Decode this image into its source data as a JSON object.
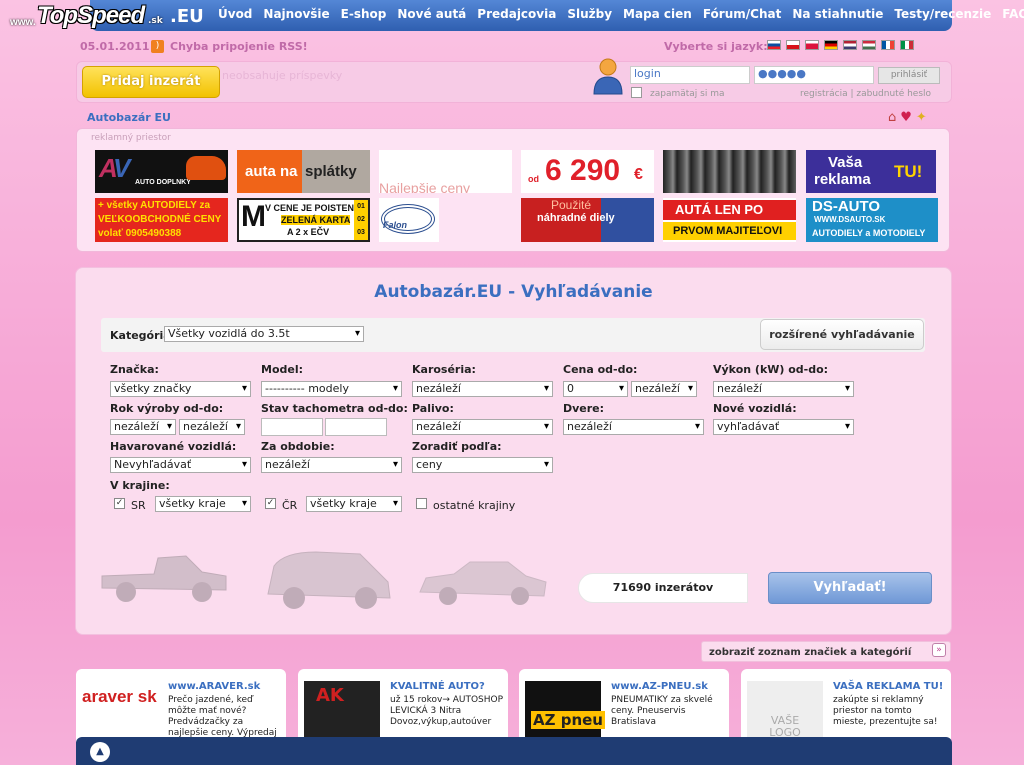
{
  "logo": {
    "www": "www.",
    "brand": "TopSpeed",
    "tld": ".sk",
    "eu": ".EU"
  },
  "nav": [
    "Úvod",
    "Najnovšie",
    "E-shop",
    "Nové autá",
    "Predajcovia",
    "Služby",
    "Mapa cien",
    "Fórum/Chat",
    "Na stiahnutie",
    "Testy/recenzie",
    "FAQ"
  ],
  "topinfo": {
    "date": "05.01.2011",
    "rss": "Chyba pripojenie RSS!",
    "language": "Vyberte si jazyk:"
  },
  "flags": [
    {
      "code": "sk",
      "colors": [
        "#ffffff",
        "#0b4ea2",
        "#ee1c25"
      ]
    },
    {
      "code": "cz",
      "colors": [
        "#ffffff",
        "#d7141a",
        "#11457e"
      ]
    },
    {
      "code": "pl",
      "colors": [
        "#ffffff",
        "#dc143c",
        "#dc143c"
      ]
    },
    {
      "code": "de",
      "colors": [
        "#000000",
        "#dd0000",
        "#ffce00"
      ]
    },
    {
      "code": "us",
      "colors": [
        "#b22234",
        "#ffffff",
        "#3c3b6e"
      ]
    },
    {
      "code": "hu",
      "colors": [
        "#cd2a3e",
        "#ffffff",
        "#436f4d"
      ]
    },
    {
      "code": "fr",
      "colors": [
        "#0055a4",
        "#ffffff",
        "#ef4135"
      ]
    },
    {
      "code": "it",
      "colors": [
        "#009246",
        "#ffffff",
        "#ce2b37"
      ]
    }
  ],
  "loginbar": {
    "add_button": "Pridaj inzerát",
    "faded_text": "neobsahuje príspevky",
    "login_value": "login",
    "password_value": "●●●●●",
    "login_button": "prihlásiť",
    "remember": "zapamätaj si ma",
    "links": "registrácia | zabudnuté heslo"
  },
  "breadcrumb": "Autobazár EU",
  "ads": {
    "label": "reklamný priestor",
    "items": [
      {
        "line1": "AUTO DOPLNKY"
      },
      {
        "line1": "auta na",
        "line2": "splátky"
      },
      {
        "line1": "Najlepšie ceny"
      },
      {
        "line1": "od",
        "line2": "6 290",
        "line3": "€"
      },
      {
        "line1": ""
      },
      {
        "line1": "Vaša",
        "line2": "reklama",
        "line3": "TU!"
      },
      {
        "line1": "+ všetky AUTODIELY za",
        "line2": "VEĽKOOBCHODNÉ CENY",
        "line3": "volať 0905490388"
      },
      {
        "line1": "M",
        "line2": "V CENE JE POISTENIE",
        "line3": "ZELENÁ KARTA",
        "line4": "A 2 x EČV",
        "nums": [
          "01",
          "02",
          "03"
        ]
      },
      {
        "line1": "Falon"
      },
      {
        "line1": "Použité",
        "line2": "náhradné diely"
      },
      {
        "line1": "AUTÁ LEN PO",
        "line2": "PRVOM MAJITEĽOVI"
      },
      {
        "line1": "DS-AUTO",
        "line2": "WWW.DSAUTO.SK",
        "line3": "AUTODIELY a MOTODIELY"
      }
    ]
  },
  "search": {
    "title": "Autobazár.EU - Vyhľadávanie",
    "category_label": "Kategória:",
    "category_value": "Všetky vozidlá do 3.5t",
    "advanced": "rozšírené vyhľadávanie",
    "labels": {
      "brand": "Značka:",
      "model": "Model:",
      "body": "Karoséria:",
      "price": "Cena od-do:",
      "power": "Výkon (kW) od-do:",
      "year": "Rok výroby od-do:",
      "mileage": "Stav tachometra od-do:",
      "fuel": "Palivo:",
      "doors": "Dvere:",
      "new": "Nové vozidlá:",
      "damaged": "Havarované vozidlá:",
      "period": "Za obdobie:",
      "sort": "Zoradiť podľa:",
      "region": "V krajine:"
    },
    "values": {
      "brand": "všetky značky",
      "model": "---------- modely",
      "body": "nezáleží",
      "price_from": "0",
      "price_to": "nezáleží",
      "power": "nezáleží",
      "year_from": "nezáleží",
      "year_to": "nezáleží",
      "fuel": "nezáleží",
      "doors": "nezáleží",
      "new": "vyhľadávať",
      "damaged": "Nevyhľadávať",
      "period": "nezáleží",
      "sort": "ceny",
      "sr": "SR",
      "sr_regions": "všetky kraje",
      "cr": "ČR",
      "cr_regions": "všetky kraje",
      "other": "ostatné krajiny"
    },
    "count": "71690 inzerátov",
    "button": "Vyhľadať!"
  },
  "brand_list": "zobraziť zoznam značiek a kategórií",
  "cards": [
    {
      "logo": "araver sk",
      "title": "www.ARAVER.sk",
      "text": "Prečo jazdené, keď môžte mať nové? Predvádzačky za najlepšie ceny. Výpredaj"
    },
    {
      "logo": "AK",
      "title": "KVALITNÉ AUTO?",
      "text": "už 15 rokov→ AUTOSHOP LEVICKÁ 3 Nitra Dovoz,výkup,autoúver"
    },
    {
      "logo": "AZ pneu",
      "title": "www.AZ-PNEU.sk",
      "text": "PNEUMATIKY za skvelé ceny. Pneuservis Bratislava"
    },
    {
      "logo": "VAŠE LOGO",
      "title": "VAŠA REKLAMA TU!",
      "text": "zakúpte si reklamný priestor na tomto mieste, prezentujte sa!"
    }
  ],
  "colors": {
    "nav": "#3b6fc0",
    "accent": "#f2c200",
    "pink": "#f7acd8"
  }
}
